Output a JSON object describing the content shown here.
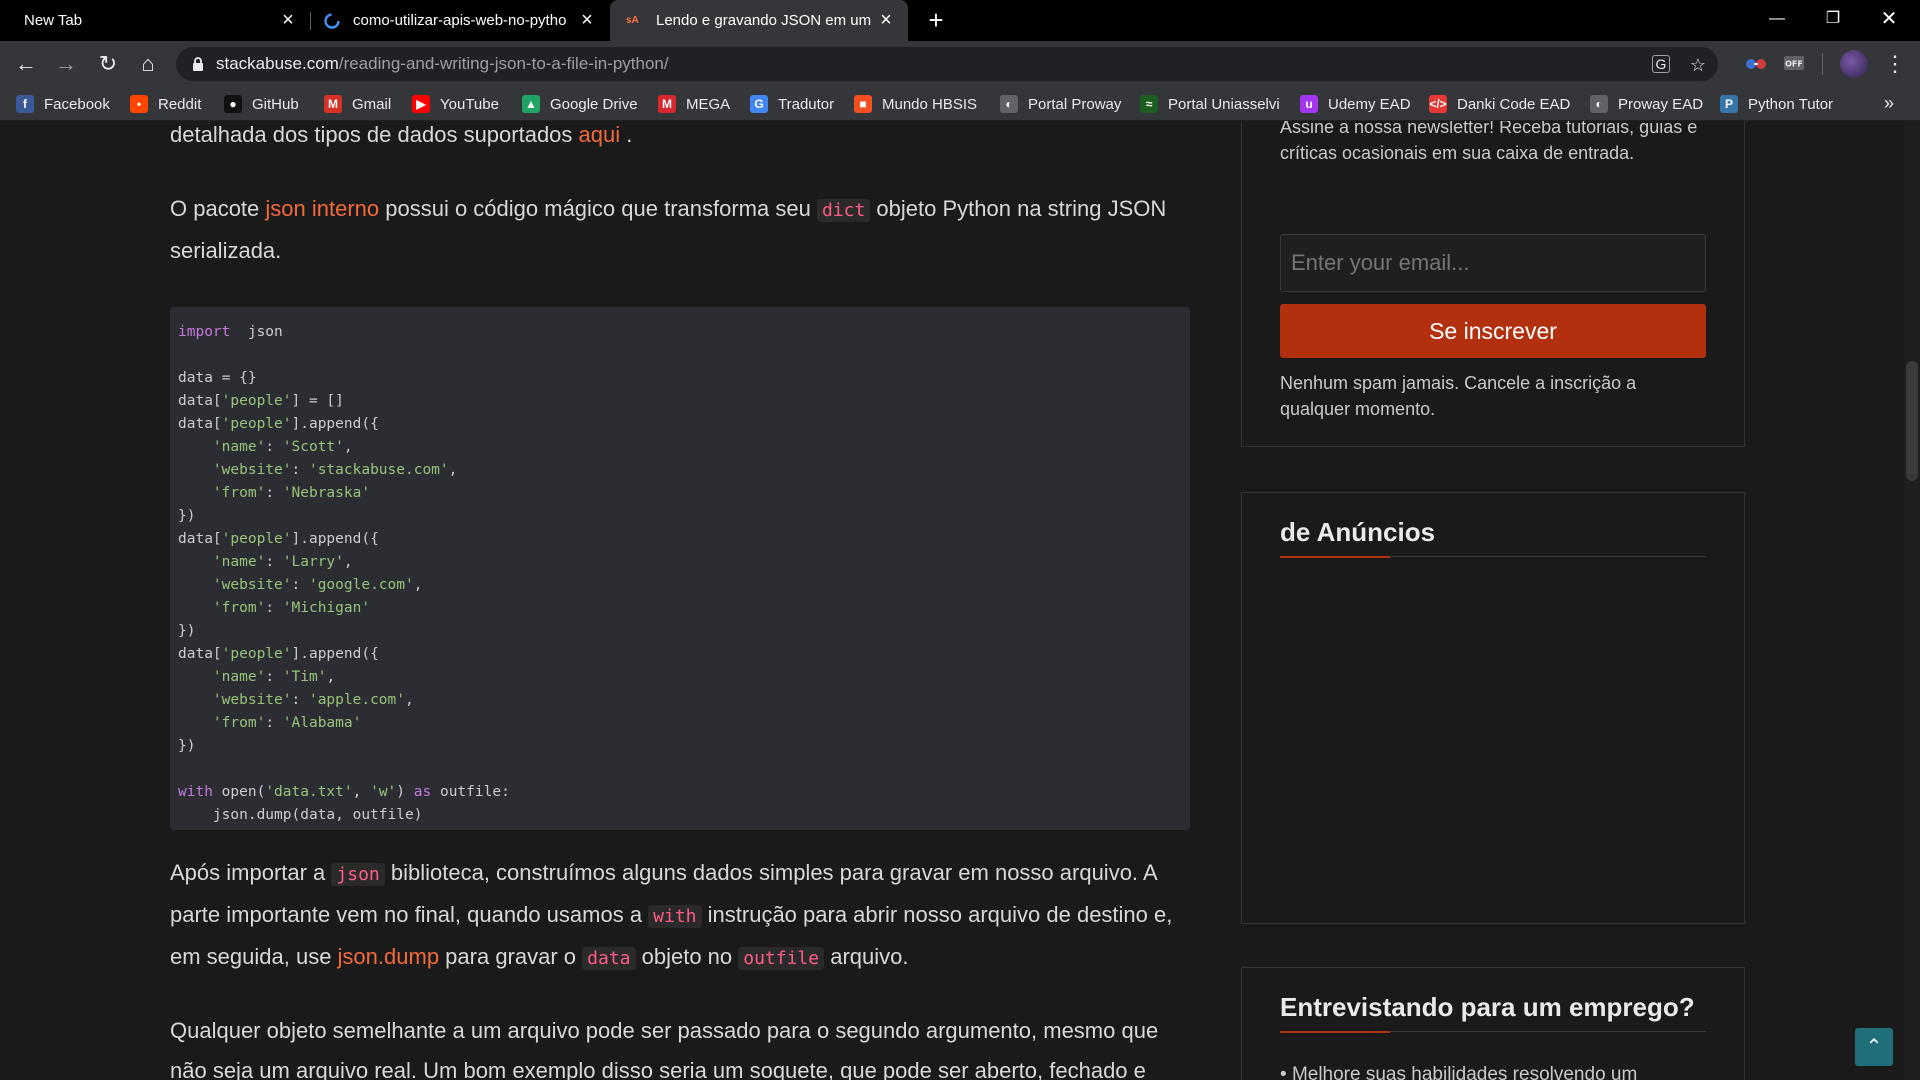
{
  "tabs": [
    {
      "title": "New Tab",
      "active": false
    },
    {
      "title": "como-utilizar-apis-web-no-pytho",
      "active": false
    },
    {
      "title": "Lendo e gravando JSON em um a",
      "active": true,
      "favicon_text": "sA"
    }
  ],
  "address_bar": {
    "domain": "stackabuse.com",
    "path": "/reading-and-writing-json-to-a-file-in-python/"
  },
  "bookmarks": [
    {
      "label": "Facebook",
      "icon": "facebook-icon",
      "color": "#3b5998",
      "glyph": "f"
    },
    {
      "label": "Reddit",
      "icon": "reddit-icon",
      "color": "#ff4500",
      "glyph": "•"
    },
    {
      "label": "GitHub",
      "icon": "github-icon",
      "color": "#111111",
      "glyph": "●"
    },
    {
      "label": "Gmail",
      "icon": "gmail-icon",
      "color": "#d93025",
      "glyph": "M"
    },
    {
      "label": "YouTube",
      "icon": "youtube-icon",
      "color": "#ff0000",
      "glyph": "▶"
    },
    {
      "label": "Google Drive",
      "icon": "google-drive-icon",
      "color": "#1fa463",
      "glyph": "▲"
    },
    {
      "label": "MEGA",
      "icon": "mega-icon",
      "color": "#d9272e",
      "glyph": "M"
    },
    {
      "label": "Tradutor",
      "icon": "translate-icon",
      "color": "#4285f4",
      "glyph": "G"
    },
    {
      "label": "Mundo HBSIS",
      "icon": "windows-icon",
      "color": "#f25022",
      "glyph": "■"
    },
    {
      "label": "Portal Proway",
      "icon": "globe-icon",
      "color": "#5f6368",
      "glyph": "◐"
    },
    {
      "label": "Portal Uniasselvi",
      "icon": "uniasselvi-icon",
      "color": "#1b5e20",
      "glyph": "≈"
    },
    {
      "label": "Udemy EAD",
      "icon": "udemy-icon",
      "color": "#a435f0",
      "glyph": "u"
    },
    {
      "label": "Danki Code EAD",
      "icon": "code-icon",
      "color": "#e53935",
      "glyph": "</>"
    },
    {
      "label": "Proway EAD",
      "icon": "globe-icon",
      "color": "#5f6368",
      "glyph": "◐"
    },
    {
      "label": "Python Tutor",
      "icon": "python-icon",
      "color": "#3776ab",
      "glyph": "P"
    }
  ],
  "article": {
    "p0_text": "detalhada dos tipos de dados suportados ",
    "p0_link": "aqui",
    "p0_end": " .",
    "p1_a": "O pacote ",
    "p1_link": "json interno",
    "p1_b": " possui o código mágico que transforma seu ",
    "p1_code": "dict",
    "p1_c": " objeto Python na string JSON serializada.",
    "p2_a": "Após importar a ",
    "p2_code1": "json",
    "p2_b": " biblioteca, construímos alguns dados simples para gravar em nosso arquivo. A parte importante vem no final, quando usamos a ",
    "p2_code2": "with",
    "p2_c": " instrução para abrir nosso arquivo de destino e, em seguida, use ",
    "p2_link": "json.dump",
    "p2_d": " para gravar o ",
    "p2_code3": "data",
    "p2_e": " objeto no ",
    "p2_code4": "outfile",
    "p2_f": " arquivo.",
    "p3": "Qualquer objeto semelhante a um arquivo pode ser passado para o segundo argumento, mesmo que não seja um arquivo real. Um bom exemplo disso seria um soquete, que pode ser aberto, fechado e"
  },
  "code_lines": [
    [
      [
        "kw",
        "import"
      ],
      [
        "",
        "  json"
      ]
    ],
    [],
    [
      [
        "",
        "data = {}"
      ]
    ],
    [
      [
        "",
        "data["
      ],
      [
        "str",
        "'people'"
      ],
      [
        "",
        "] = []"
      ]
    ],
    [
      [
        "",
        "data["
      ],
      [
        "str",
        "'people'"
      ],
      [
        "",
        "].append({"
      ]
    ],
    [
      [
        "",
        "    "
      ],
      [
        "str",
        "'name'"
      ],
      [
        "",
        ": "
      ],
      [
        "str",
        "'Scott'"
      ],
      [
        "",
        ","
      ]
    ],
    [
      [
        "",
        "    "
      ],
      [
        "str",
        "'website'"
      ],
      [
        "",
        ": "
      ],
      [
        "str",
        "'stackabuse.com'"
      ],
      [
        "",
        ","
      ]
    ],
    [
      [
        "",
        "    "
      ],
      [
        "str",
        "'from'"
      ],
      [
        "",
        ": "
      ],
      [
        "str",
        "'Nebraska'"
      ]
    ],
    [
      [
        "",
        "})"
      ]
    ],
    [
      [
        "",
        "data["
      ],
      [
        "str",
        "'people'"
      ],
      [
        "",
        "].append({"
      ]
    ],
    [
      [
        "",
        "    "
      ],
      [
        "str",
        "'name'"
      ],
      [
        "",
        ": "
      ],
      [
        "str",
        "'Larry'"
      ],
      [
        "",
        ","
      ]
    ],
    [
      [
        "",
        "    "
      ],
      [
        "str",
        "'website'"
      ],
      [
        "",
        ": "
      ],
      [
        "str",
        "'google.com'"
      ],
      [
        "",
        ","
      ]
    ],
    [
      [
        "",
        "    "
      ],
      [
        "str",
        "'from'"
      ],
      [
        "",
        ": "
      ],
      [
        "str",
        "'Michigan'"
      ]
    ],
    [
      [
        "",
        "})"
      ]
    ],
    [
      [
        "",
        "data["
      ],
      [
        "str",
        "'people'"
      ],
      [
        "",
        "].append({"
      ]
    ],
    [
      [
        "",
        "    "
      ],
      [
        "str",
        "'name'"
      ],
      [
        "",
        ": "
      ],
      [
        "str",
        "'Tim'"
      ],
      [
        "",
        ","
      ]
    ],
    [
      [
        "",
        "    "
      ],
      [
        "str",
        "'website'"
      ],
      [
        "",
        ": "
      ],
      [
        "str",
        "'apple.com'"
      ],
      [
        "",
        ","
      ]
    ],
    [
      [
        "",
        "    "
      ],
      [
        "str",
        "'from'"
      ],
      [
        "",
        ": "
      ],
      [
        "str",
        "'Alabama'"
      ]
    ],
    [
      [
        "",
        "})"
      ]
    ],
    [],
    [
      [
        "kw",
        "with"
      ],
      [
        "",
        " open("
      ],
      [
        "str",
        "'data.txt'"
      ],
      [
        "",
        ", "
      ],
      [
        "str",
        "'w'"
      ],
      [
        "",
        ") "
      ],
      [
        "kw",
        "as"
      ],
      [
        "",
        " outfile:"
      ]
    ],
    [
      [
        "",
        "    json.dump(data, outfile)"
      ]
    ]
  ],
  "newsletter": {
    "text": "Assine a nossa newsletter! Receba tutoriais, guias e críticas ocasionais em sua caixa de entrada.",
    "email_placeholder": "Enter your email...",
    "button": "Se inscrever",
    "disclaimer": "Nenhum spam jamais. Cancele a inscrição a qualquer momento."
  },
  "ads_widget": {
    "title": "de Anúncios"
  },
  "interview_widget": {
    "title": "Entrevistando para um emprego?",
    "item": "Melhore suas habilidades resolvendo um"
  },
  "colors": {
    "accent": "#f26a3c",
    "button": "#b3300f",
    "inline_code": "#ff5c86"
  }
}
